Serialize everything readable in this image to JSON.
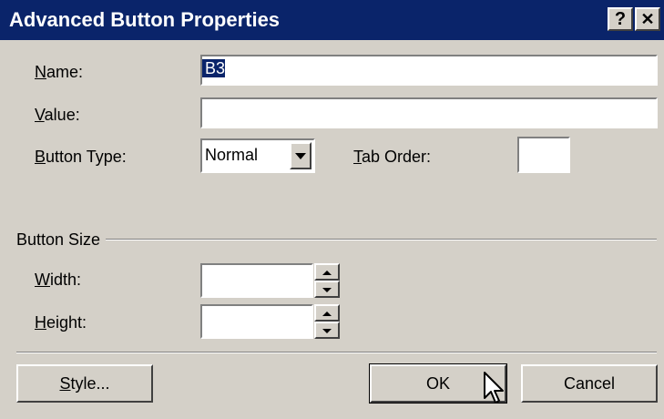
{
  "window": {
    "title": "Advanced Button Properties",
    "help_button": "?",
    "close_button": "✕"
  },
  "fields": {
    "name_label": "Name:",
    "name_value": "B3",
    "value_label": "Value:",
    "value_value": "",
    "button_type_label": "Button Type:",
    "button_type_value": "Normal",
    "tab_order_label": "Tab Order:",
    "tab_order_value": ""
  },
  "button_size": {
    "group_label": "Button Size",
    "width_label": "Width:",
    "width_value": "",
    "height_label": "Height:",
    "height_value": ""
  },
  "buttons": {
    "style": "Style...",
    "ok": "OK",
    "cancel": "Cancel"
  }
}
